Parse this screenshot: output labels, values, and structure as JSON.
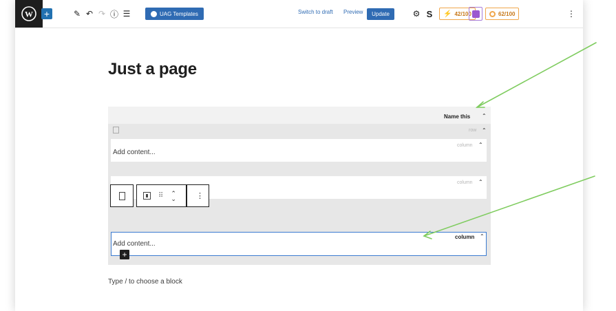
{
  "toolbar": {
    "uag_label": "UAG Templates",
    "switch_draft": "Switch to draft",
    "preview": "Preview",
    "update": "Update",
    "seo_score": "42/100",
    "readability_score": "62/100"
  },
  "editor": {
    "page_title": "Just a page",
    "group_label": "Name this",
    "row_label": "row",
    "columns": [
      {
        "label": "column",
        "text": "Add content..."
      },
      {
        "label": "column",
        "text": ""
      },
      {
        "label": "column",
        "text": "Add content..."
      }
    ],
    "hint": "Type / to choose a block"
  },
  "colors": {
    "accent": "#2f6bb3",
    "annotation_arrow": "#7fcc5f",
    "score_orange": "#f0a64a"
  }
}
